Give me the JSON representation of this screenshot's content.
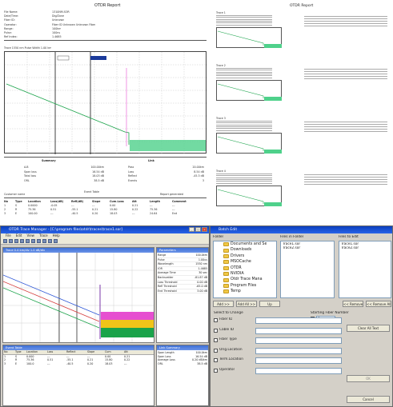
{
  "report": {
    "title": "OTDR Report",
    "fields": [
      {
        "label": "File Name:",
        "value": "1310NM.SOR"
      },
      {
        "label": "Date/Time:",
        "value": "Dig/Zone"
      },
      {
        "label": "Fiber ID:",
        "value": "Unknown"
      },
      {
        "label": "Operator:",
        "value": "Fiber ID Unknown Unknown Fiber"
      },
      {
        "label": "Range:",
        "value": "100km"
      },
      {
        "label": "Pulse:",
        "value": "100ns"
      },
      {
        "label": "Ref Index:",
        "value": "1.4685"
      }
    ],
    "trace_header": "Trace 1550 nm Pulse Width 1.00 km",
    "cursor_a_label": "A",
    "cursor_b_label": "B",
    "summary_left_title": "Summary",
    "summary_right_title": "Link",
    "summary_left": [
      {
        "k": "A-B",
        "v": "100.00km"
      },
      {
        "k": "Span loss",
        "v": "16.54 dB"
      },
      {
        "k": "Total loss",
        "v": "18.03 dB"
      },
      {
        "k": "ORL",
        "v": "38.5 dB"
      }
    ],
    "summary_right": [
      {
        "k": "Pass",
        "v": "20.00km"
      },
      {
        "k": "Loss",
        "v": "8.54 dB"
      },
      {
        "k": "Reflect",
        "v": "-45.3 dB"
      },
      {
        "k": "Events",
        "v": "3"
      }
    ],
    "footer_left": "Customer name",
    "footer_center": "Event Table",
    "footer_right": "Report generated",
    "event_headers": [
      "No",
      "Type",
      "Location",
      "Loss(dB)",
      "Refl(dB)",
      "Slope",
      "Cum.Loss",
      "Att",
      "Length",
      "Comment"
    ],
    "events": [
      [
        "1",
        "S",
        "0.0000",
        "-0.05",
        "---",
        "---",
        "0.00",
        "0.21",
        "---",
        "---"
      ],
      [
        "2",
        "R",
        "75.36",
        "0.51",
        "-55.1",
        "0.21",
        "15.80",
        "0.22",
        "75.36",
        "---"
      ],
      [
        "3",
        "E",
        "100.00",
        "---",
        "-40.5",
        "0.20",
        "18.03",
        "---",
        "24.64",
        "End"
      ]
    ]
  },
  "report2": {
    "title": "OTDR Report",
    "panels": [
      "Trace 1",
      "Trace 2",
      "Trace 3",
      "Trace 4"
    ]
  },
  "app": {
    "title": "OTDR Trace Manager - [C:\\program files\\otdr\\traces\\trace1.sor]",
    "menu": [
      "File",
      "Edit",
      "View",
      "Trace",
      "Help"
    ],
    "trace_pane_title": "Trace 0.4 km/div  1.0 dB/div",
    "params_title": "Parameters",
    "params": [
      {
        "k": "Range",
        "v": "100.0km"
      },
      {
        "k": "Pulse",
        "v": "1.00us"
      },
      {
        "k": "Wavelength",
        "v": "1550 nm"
      },
      {
        "k": "IOR",
        "v": "1.4685"
      },
      {
        "k": "Average Time",
        "v": "30 sec"
      },
      {
        "k": "Backscatter",
        "v": "-81.87 dB"
      },
      {
        "k": "Loss Threshold",
        "v": "0.00 dB"
      },
      {
        "k": "Refl Threshold",
        "v": "-65.0 dB"
      },
      {
        "k": "End Threshold",
        "v": "3.00 dB"
      }
    ],
    "event_list_title": "Event Table",
    "event_cols": [
      "No",
      "Type",
      "Location",
      "Loss",
      "Reflect",
      "Slope",
      "Cum",
      "Att"
    ],
    "event_rows": [
      [
        "1",
        "S",
        "0.000",
        "---",
        "---",
        "---",
        "0.00",
        "0.21"
      ],
      [
        "2",
        "R",
        "75.36",
        "0.51",
        "-55.1",
        "0.21",
        "15.80",
        "0.22"
      ],
      [
        "3",
        "E",
        "100.0",
        "---",
        "-40.5",
        "0.20",
        "18.03",
        "---"
      ]
    ],
    "link_title": "Link Summary",
    "link_rows": [
      {
        "k": "Span Length",
        "v": "100.0km"
      },
      {
        "k": "Span Loss",
        "v": "16.54 dB"
      },
      {
        "k": "Average Loss",
        "v": "0.20 dB/km"
      },
      {
        "k": "ORL",
        "v": "38.5 dB"
      }
    ],
    "colors": {
      "accent": "#2a64e8",
      "trace_green": "#1aa34a",
      "trace_pink": "#e64fd0",
      "trace_yellow": "#f0c419"
    }
  },
  "dialog": {
    "title": "Batch Edit",
    "folder_header": "Folder",
    "files_header": "Files in Folder",
    "selected_header": "Files to Edit",
    "tree": [
      "Documents and Se",
      "Downloads",
      "Drivers",
      "MSOCache",
      "OTDR",
      "NVIDIA",
      "Otdr Trace Mana",
      "Program Files",
      "Temp"
    ],
    "files_in_folder": [
      "Trace1.sor",
      "Trace2.sor"
    ],
    "files_to_edit": [
      "Trace1.sor",
      "Trace2.sor"
    ],
    "btn_add": "Add >>",
    "btn_add_all": "Add All >>",
    "btn_remove": "<< Remove",
    "btn_remove_all": "<< Remove All",
    "btn_up": "Up",
    "select_label": "Select to Change",
    "starting_label": "Starting Fiber Number",
    "fields": [
      "Fiber ID",
      "Cable ID",
      "Fiber Type",
      "Orig.Location",
      "Term.Location",
      "Operator"
    ],
    "clear_label": "Clear All Text",
    "ok_label": "OK",
    "cancel_label": "Cancel",
    "starting_value": "1"
  }
}
